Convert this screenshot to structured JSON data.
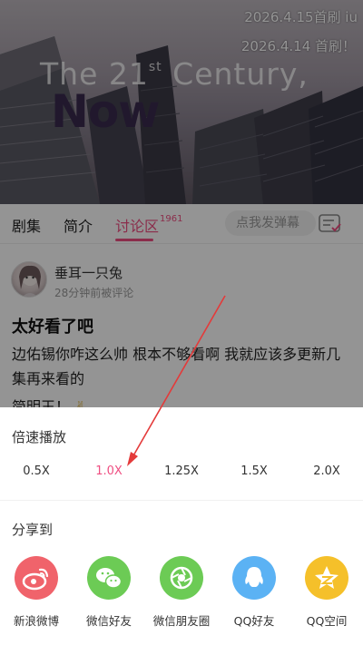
{
  "video": {
    "danmaku": [
      "2026.4.15首刷  iu",
      "2026.4.14 首刷！"
    ],
    "title_line": "The 21",
    "title_sup": "st",
    "title_line_end": " Century,",
    "title_now": "Now"
  },
  "tabs": {
    "items": [
      "剧集",
      "简介",
      "讨论区"
    ],
    "count": "1961",
    "danmaku_placeholder": "点我发弹幕"
  },
  "comment": {
    "username": "垂耳一只兔",
    "time": "28分钟前被评论",
    "title": "太好看了吧",
    "body": "边佑锡你咋这么帅 根本不够看啊 我就应该多更新几集再来看的",
    "body_partial": "简明王！"
  },
  "speed": {
    "title": "倍速播放",
    "options": [
      "0.5X",
      "1.0X",
      "1.25X",
      "1.5X",
      "2.0X"
    ],
    "selected": "1.0X"
  },
  "share": {
    "title": "分享到",
    "items": [
      {
        "label": "新浪微博",
        "icon": "weibo-icon",
        "color": "#f0636b"
      },
      {
        "label": "微信好友",
        "icon": "wechat-icon",
        "color": "#6ccb55"
      },
      {
        "label": "微信朋友圈",
        "icon": "moments-icon",
        "color": "#6ccb55"
      },
      {
        "label": "QQ好友",
        "icon": "qq-icon",
        "color": "#5bb2f4"
      },
      {
        "label": "QQ空间",
        "icon": "qzone-icon",
        "color": "#f5c02a"
      }
    ]
  },
  "colors": {
    "accent": "#ef4f82"
  }
}
